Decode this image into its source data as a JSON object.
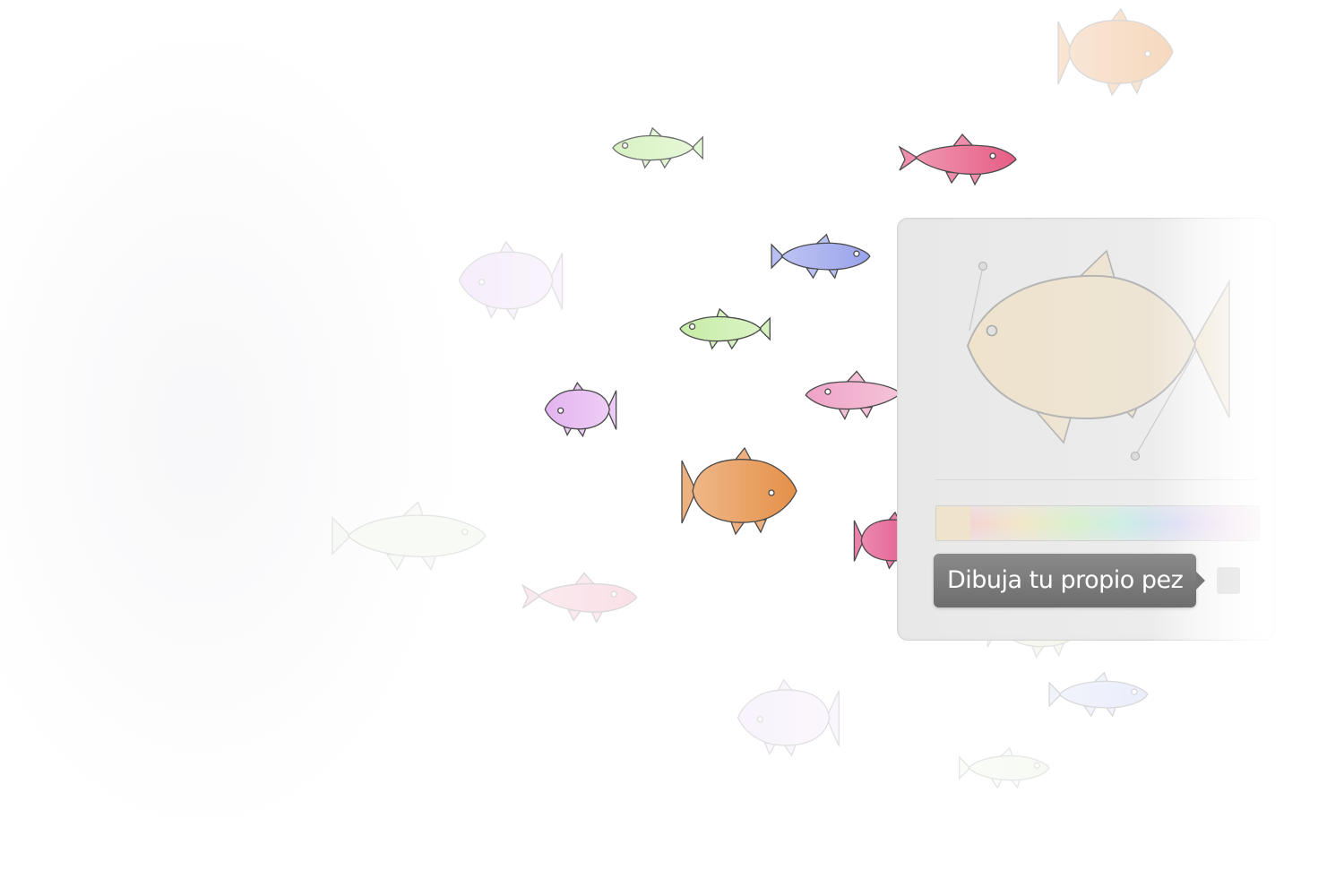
{
  "tooltip": {
    "text": "Dibuja tu propio pez"
  },
  "colors": {
    "selected_color": "#efe3cc",
    "panel_background": "#ebebeb",
    "tooltip_background": "#7a7a7a"
  },
  "icons": {
    "eye": "fish-eye-icon",
    "arrow": "tooltip-arrow-icon"
  },
  "fish": [
    {
      "id": "peach-top",
      "shape": "round",
      "color": "#f3c9a4",
      "opacity": 0.7,
      "dir": "right"
    },
    {
      "id": "lime-top",
      "shape": "slim",
      "color": "#cff0b4",
      "opacity": 0.8,
      "dir": "left"
    },
    {
      "id": "crimson",
      "shape": "sleek",
      "color": "#e65d85",
      "opacity": 1,
      "dir": "right"
    },
    {
      "id": "lavender-ghost",
      "shape": "round",
      "color": "#efe1f8",
      "opacity": 0.55,
      "dir": "left"
    },
    {
      "id": "blue",
      "shape": "slim",
      "color": "#9aa3ec",
      "opacity": 1,
      "dir": "right"
    },
    {
      "id": "lime-mid",
      "shape": "slim",
      "color": "#c6eda6",
      "opacity": 1,
      "dir": "left"
    },
    {
      "id": "pink-mid",
      "shape": "sleek",
      "color": "#efa3c6",
      "opacity": 1,
      "dir": "left"
    },
    {
      "id": "violet",
      "shape": "round",
      "color": "#e3b3f0",
      "opacity": 1,
      "dir": "left"
    },
    {
      "id": "orange",
      "shape": "round",
      "color": "#e59048",
      "opacity": 1,
      "dir": "right"
    },
    {
      "id": "magenta-behind",
      "shape": "round",
      "color": "#e14b85",
      "opacity": 1,
      "dir": "right"
    },
    {
      "id": "mint-ghost",
      "shape": "slim",
      "color": "#eef4e8",
      "opacity": 0.45,
      "dir": "right"
    },
    {
      "id": "pink-low",
      "shape": "sleek",
      "color": "#f7d3dd",
      "opacity": 0.7,
      "dir": "right"
    },
    {
      "id": "lavender-low",
      "shape": "round",
      "color": "#f3eafa",
      "opacity": 0.55,
      "dir": "left"
    },
    {
      "id": "periwinkle-low",
      "shape": "slim",
      "color": "#e2e6fa",
      "opacity": 0.7,
      "dir": "right"
    },
    {
      "id": "mint-low",
      "shape": "slim",
      "color": "#eef6e6",
      "opacity": 0.45,
      "dir": "right"
    },
    {
      "id": "olive-ghost",
      "shape": "round",
      "color": "#e8eed8",
      "opacity": 0.5,
      "dir": "right"
    }
  ]
}
